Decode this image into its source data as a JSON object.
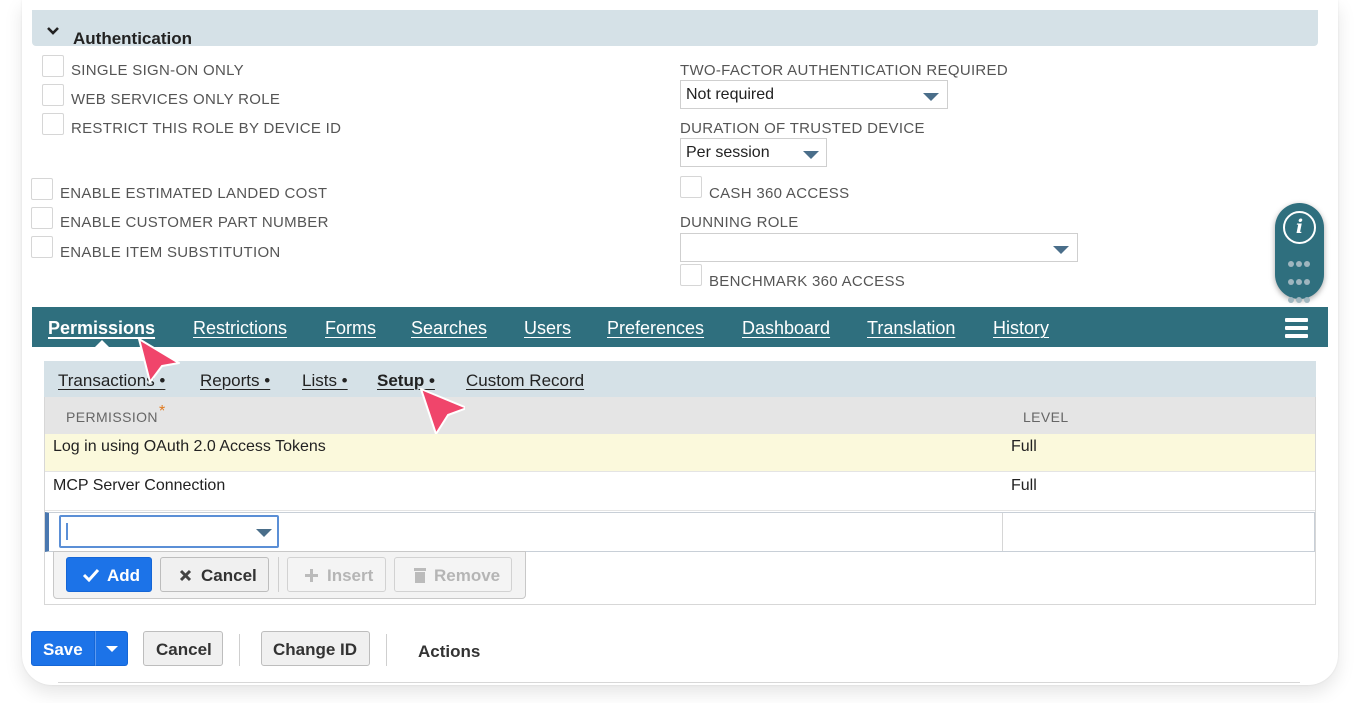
{
  "section": {
    "title": "Authentication"
  },
  "left_checkboxes_top": [
    {
      "label": "SINGLE SIGN-ON ONLY"
    },
    {
      "label": "WEB SERVICES ONLY ROLE"
    },
    {
      "label": "RESTRICT THIS ROLE BY DEVICE ID"
    }
  ],
  "left_checkboxes_bottom": [
    {
      "label": "ENABLE ESTIMATED LANDED COST"
    },
    {
      "label": "ENABLE CUSTOMER PART NUMBER"
    },
    {
      "label": "ENABLE ITEM SUBSTITUTION"
    }
  ],
  "right_fields": {
    "two_factor_label": "TWO-FACTOR AUTHENTICATION REQUIRED",
    "two_factor_value": "Not required",
    "trusted_device_label": "DURATION OF TRUSTED DEVICE",
    "trusted_device_value": "Per session",
    "cash360_label": "CASH 360 ACCESS",
    "dunning_label": "DUNNING ROLE",
    "dunning_value": "",
    "benchmark_label": "BENCHMARK 360 ACCESS"
  },
  "tabs": [
    {
      "label": "Permissions",
      "active": true
    },
    {
      "label": "Restrictions"
    },
    {
      "label": "Forms"
    },
    {
      "label": "Searches"
    },
    {
      "label": "Users"
    },
    {
      "label": "Preferences"
    },
    {
      "label": "Dashboard"
    },
    {
      "label": "Translation"
    },
    {
      "label": "History"
    }
  ],
  "subtabs": [
    {
      "label": "Transactions •"
    },
    {
      "label": "Reports •"
    },
    {
      "label": "Lists •"
    },
    {
      "label": "Setup •",
      "active": true
    },
    {
      "label": "Custom Record"
    }
  ],
  "table": {
    "columns": [
      "PERMISSION",
      "LEVEL"
    ],
    "required_marker": "*",
    "rows": [
      {
        "permission": "Log in using OAuth 2.0 Access Tokens",
        "level": "Full"
      },
      {
        "permission": "MCP Server Connection",
        "level": "Full"
      }
    ],
    "edit_row_value": ""
  },
  "row_buttons": {
    "add": "Add",
    "cancel": "Cancel",
    "insert": "Insert",
    "remove": "Remove"
  },
  "footer_buttons": {
    "save": "Save",
    "cancel": "Cancel",
    "change_id": "Change ID",
    "actions": "Actions"
  },
  "info_widget": {
    "glyph": "i"
  },
  "colors": {
    "tab_bar": "#2f6f7e",
    "section_header": "#d5e1e7",
    "primary_button": "#1c73e8",
    "highlight_row": "#fbf9dc",
    "cursor": "#f0456b"
  },
  "icons": [
    "chevron-down-icon",
    "dropdown-triangle-icon",
    "hamburger-menu-icon",
    "check-icon",
    "x-icon",
    "plus-icon",
    "trash-icon",
    "info-icon",
    "dots-grid-icon",
    "cursor-arrow-icon"
  ]
}
